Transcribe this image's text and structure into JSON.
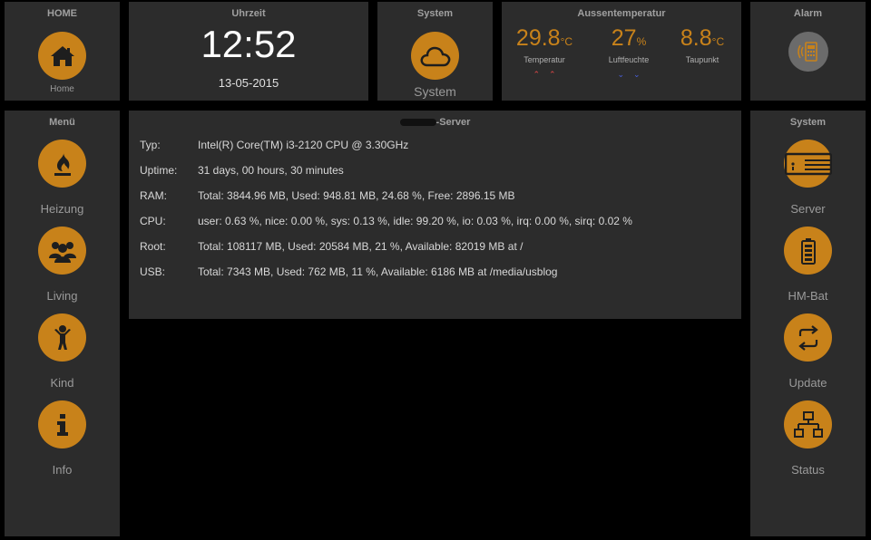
{
  "home_panel": {
    "title": "HOME",
    "button_label": "Home",
    "icon": "house-icon"
  },
  "clock_panel": {
    "title": "Uhrzeit",
    "time": "12:52",
    "date": "13-05-2015"
  },
  "system_top_panel": {
    "title": "System",
    "button_label": "System",
    "icon": "cloud-icon"
  },
  "outdoor_panel": {
    "title": "Aussentemperatur",
    "readings": [
      {
        "value": "29.8",
        "unit": "°C",
        "label": "Temperatur",
        "trend": "⌃⌃",
        "trend_color": "#e04848"
      },
      {
        "value": "27",
        "unit": "%",
        "label": "Luftfeuchte",
        "trend": "⌄⌄",
        "trend_color": "#4a60e0"
      },
      {
        "value": "8.8",
        "unit": "°C",
        "label": "Taupunkt",
        "trend": "",
        "trend_color": "#9a9a9a"
      }
    ]
  },
  "alarm_panel": {
    "title": "Alarm",
    "icon": "alarm-keypad-icon"
  },
  "menu_panel": {
    "title": "Menü",
    "items": [
      {
        "label": "Heizung",
        "icon": "flame-icon"
      },
      {
        "label": "Living",
        "icon": "people-icon"
      },
      {
        "label": "Kind",
        "icon": "child-icon"
      },
      {
        "label": "Info",
        "icon": "info-icon"
      }
    ]
  },
  "server_panel": {
    "title": "-Server",
    "rows": [
      {
        "key": "Typ:",
        "value": "Intel(R) Core(TM) i3-2120 CPU @ 3.30GHz"
      },
      {
        "key": "Uptime:",
        "value": "31 days, 00 hours, 30 minutes"
      },
      {
        "key": "RAM:",
        "value": "Total: 3844.96 MB, Used: 948.81 MB, 24.68 %, Free: 2896.15 MB"
      },
      {
        "key": "CPU:",
        "value": "user: 0.63 %, nice: 0.00 %, sys: 0.13 %, idle: 99.20 %, io: 0.03 %, irq: 0.00 %, sirq: 0.02 %"
      },
      {
        "key": "Root:",
        "value": "Total: 108117 MB, Used: 20584 MB, 21 %, Available: 82019 MB at /"
      },
      {
        "key": "USB:",
        "value": "Total: 7343 MB, Used: 762 MB, 11 %, Available: 6186 MB at /media/usblog"
      }
    ]
  },
  "system_side_panel": {
    "title": "System",
    "items": [
      {
        "label": "Server",
        "icon": "server-icon"
      },
      {
        "label": "HM-Bat",
        "icon": "battery-icon"
      },
      {
        "label": "Update",
        "icon": "refresh-icon"
      },
      {
        "label": "Status",
        "icon": "network-icon"
      }
    ]
  },
  "colors": {
    "accent": "#c8821a",
    "panel": "#2c2c2c",
    "background": "#000000"
  }
}
